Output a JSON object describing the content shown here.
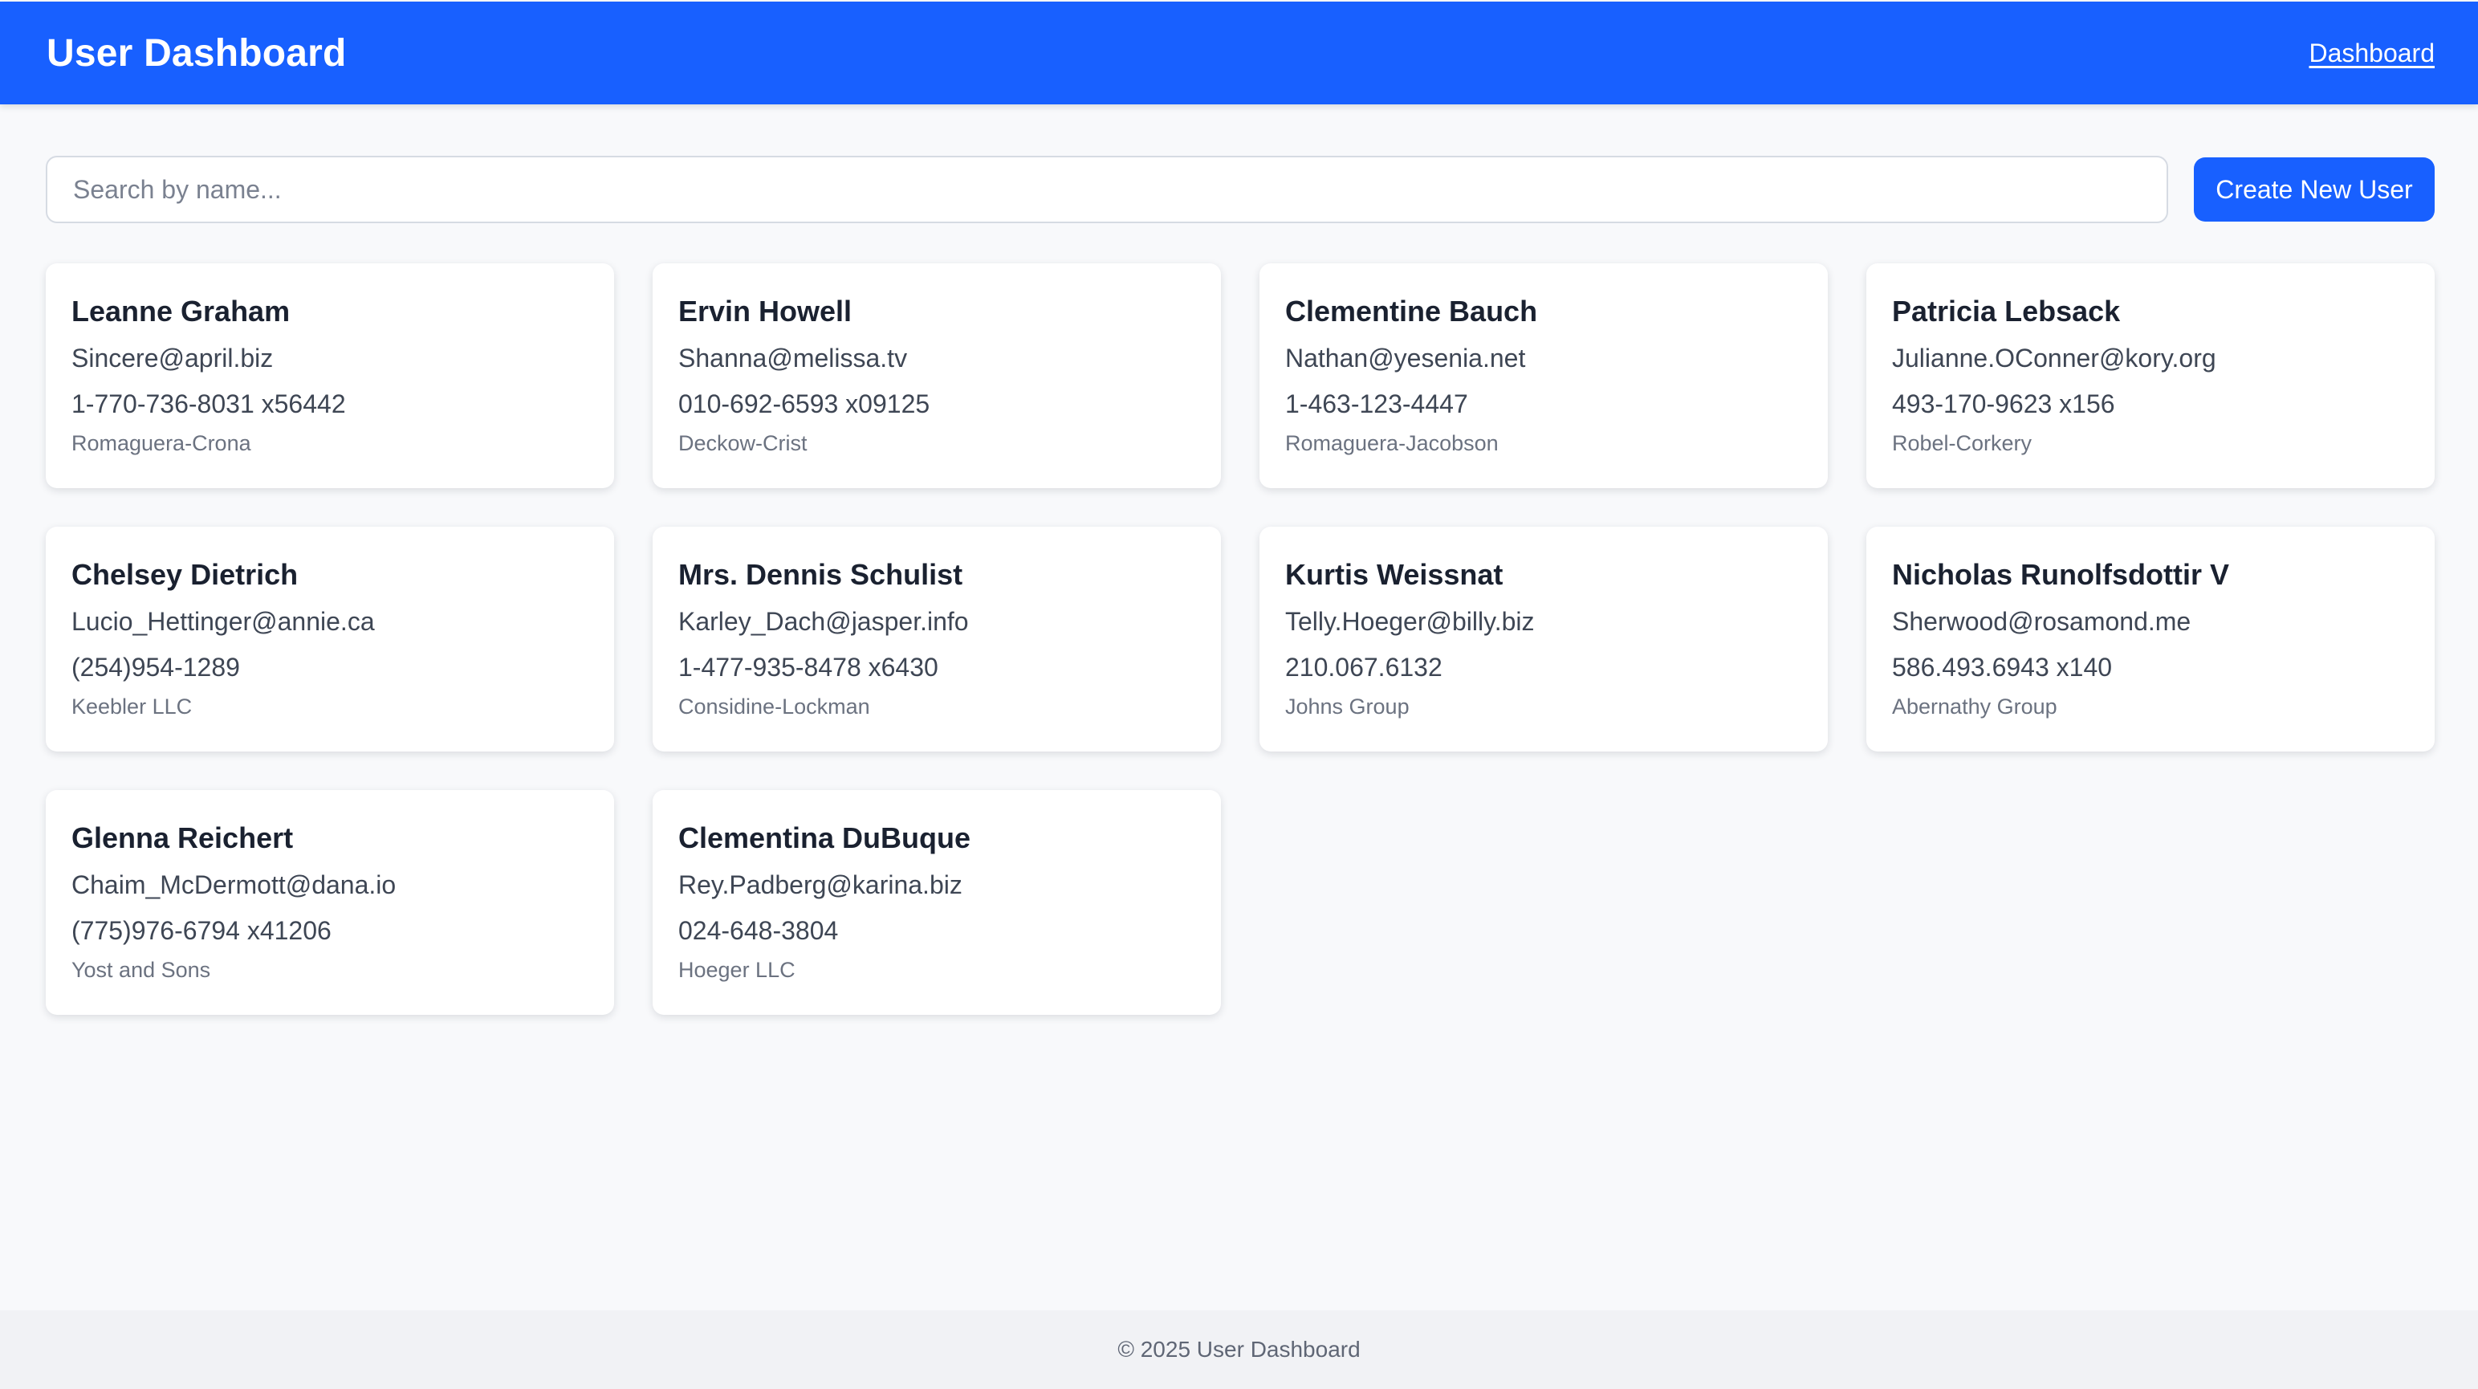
{
  "header": {
    "title": "User Dashboard",
    "nav_link": "Dashboard"
  },
  "toolbar": {
    "search_placeholder": "Search by name...",
    "search_value": "",
    "create_button_label": "Create New User"
  },
  "users": [
    {
      "name": "Leanne Graham",
      "email": "Sincere@april.biz",
      "phone": "1-770-736-8031 x56442",
      "company": "Romaguera-Crona"
    },
    {
      "name": "Ervin Howell",
      "email": "Shanna@melissa.tv",
      "phone": "010-692-6593 x09125",
      "company": "Deckow-Crist"
    },
    {
      "name": "Clementine Bauch",
      "email": "Nathan@yesenia.net",
      "phone": "1-463-123-4447",
      "company": "Romaguera-Jacobson"
    },
    {
      "name": "Patricia Lebsack",
      "email": "Julianne.OConner@kory.org",
      "phone": "493-170-9623 x156",
      "company": "Robel-Corkery"
    },
    {
      "name": "Chelsey Dietrich",
      "email": "Lucio_Hettinger@annie.ca",
      "phone": "(254)954-1289",
      "company": "Keebler LLC"
    },
    {
      "name": "Mrs. Dennis Schulist",
      "email": "Karley_Dach@jasper.info",
      "phone": "1-477-935-8478 x6430",
      "company": "Considine-Lockman"
    },
    {
      "name": "Kurtis Weissnat",
      "email": "Telly.Hoeger@billy.biz",
      "phone": "210.067.6132",
      "company": "Johns Group"
    },
    {
      "name": "Nicholas Runolfsdottir V",
      "email": "Sherwood@rosamond.me",
      "phone": "586.493.6943 x140",
      "company": "Abernathy Group"
    },
    {
      "name": "Glenna Reichert",
      "email": "Chaim_McDermott@dana.io",
      "phone": "(775)976-6794 x41206",
      "company": "Yost and Sons"
    },
    {
      "name": "Clementina DuBuque",
      "email": "Rey.Padberg@karina.biz",
      "phone": "024-648-3804",
      "company": "Hoeger LLC"
    }
  ],
  "footer": {
    "text": "© 2025 User Dashboard"
  },
  "colors": {
    "accent": "#1860ff",
    "background": "#f8f9fb",
    "card": "#ffffff"
  }
}
